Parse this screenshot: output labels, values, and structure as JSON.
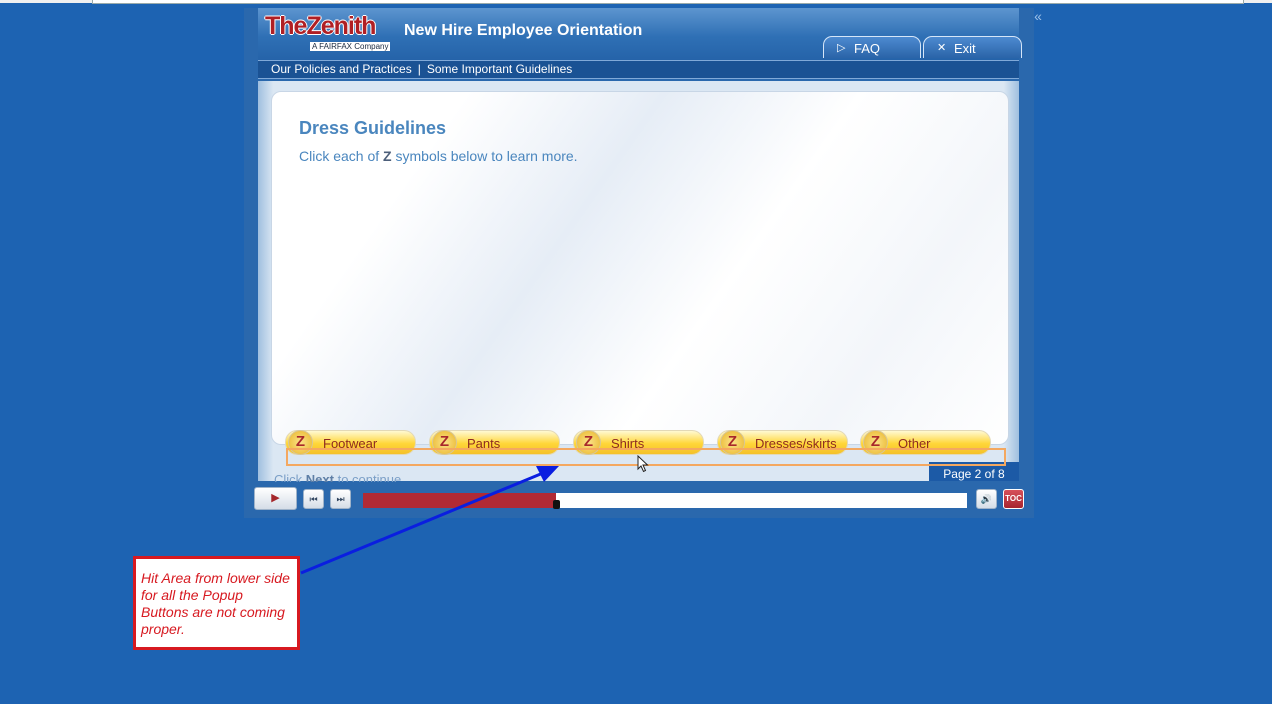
{
  "app": {
    "logo_text": "TheZenith",
    "logo_sub": "A FAIRFAX Company",
    "course_title": "New Hire Employee Orientation",
    "close_glyph": "«"
  },
  "header_buttons": {
    "faq": {
      "label": "FAQ",
      "icon": "play-arrow-icon"
    },
    "exit": {
      "label": "Exit",
      "icon": "x-icon"
    }
  },
  "breadcrumb": {
    "items": [
      "Our Policies and Practices",
      "Some Important Guidelines"
    ],
    "separator": "|"
  },
  "content": {
    "heading": "Dress Guidelines",
    "instruction_pre": "Click each of ",
    "instruction_symbol": "Z",
    "instruction_post": " symbols below to learn more."
  },
  "popup_buttons": [
    {
      "icon_letter": "Z",
      "label": "Footwear"
    },
    {
      "icon_letter": "Z",
      "label": "Pants"
    },
    {
      "icon_letter": "Z",
      "label": "Shirts"
    },
    {
      "icon_letter": "Z",
      "label": "Dresses/skirts"
    },
    {
      "icon_letter": "Z",
      "label": "Other"
    }
  ],
  "footer": {
    "hint_pre": "Click ",
    "hint_bold": "Next",
    "hint_post": " to continue.",
    "page_indicator": "Page 2 of 8"
  },
  "player": {
    "play_glyph": "▶",
    "prev_glyph": "⏮",
    "next_glyph": "⏭",
    "volume_glyph": "🔊",
    "toc_label": "TOC",
    "progress_fraction": 0.32
  },
  "annotation": {
    "note_text": "Hit Area from lower side for all the Popup Buttons are not coming proper.",
    "colors": {
      "note_border": "#d71920",
      "arrow": "#0a1ee0",
      "highlight": "#f4a860"
    }
  }
}
